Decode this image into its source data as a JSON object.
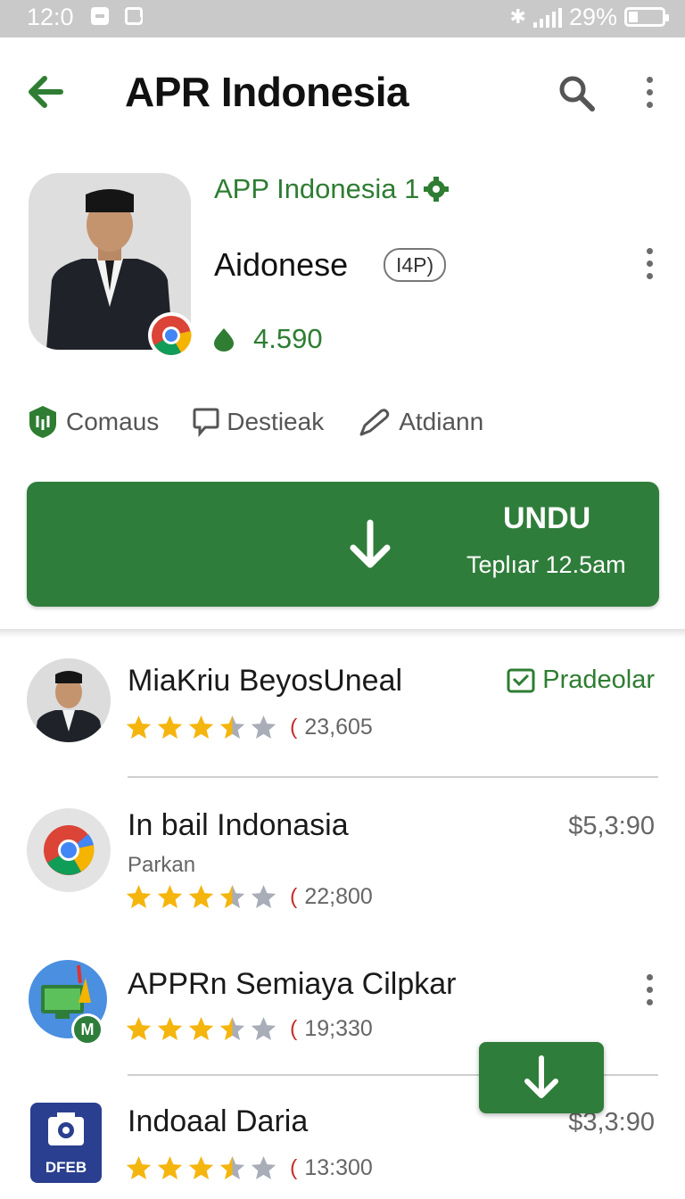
{
  "status_bar": {
    "time": "12:0",
    "battery": "29%",
    "battery_level": 0.29
  },
  "app_bar": {
    "title": "APR Indonesia",
    "back_icon": "arrow-back-icon",
    "search_icon": "search-icon",
    "more_icon": "more-vert-icon"
  },
  "app_header": {
    "developer": "APP Indonesia 1",
    "name": "Aidonese",
    "age_badge": "I4P)",
    "rating": "4.590"
  },
  "chips": [
    {
      "label": "Comaus",
      "icon": "shield-icon"
    },
    {
      "label": "Destieak",
      "icon": "comment-icon"
    },
    {
      "label": "Atdiann",
      "icon": "edit-icon"
    }
  ],
  "download": {
    "label": "UNDU",
    "sub": "Teplıar 12.5am"
  },
  "list": [
    {
      "title": "MiaKriu BeyosUneal",
      "right": "Pradeolar",
      "count": "23,605",
      "rating": 3.5
    },
    {
      "title": "In bail Indonasia",
      "sub": "Parkan",
      "right": "$5,3:90",
      "count": "22;800",
      "rating": 3.5
    },
    {
      "title": "APPRn Semiaya Cilpkar",
      "count": "19;330",
      "rating": 3.5
    },
    {
      "title": "Indoaal Daria",
      "right": "$3,3:90",
      "count": "13:300",
      "rating": 3.5,
      "icon_label": "DFEB"
    }
  ],
  "colors": {
    "accent": "#2f7d3b",
    "star": "#f5b50f",
    "star_empty": "#a8adb8"
  }
}
